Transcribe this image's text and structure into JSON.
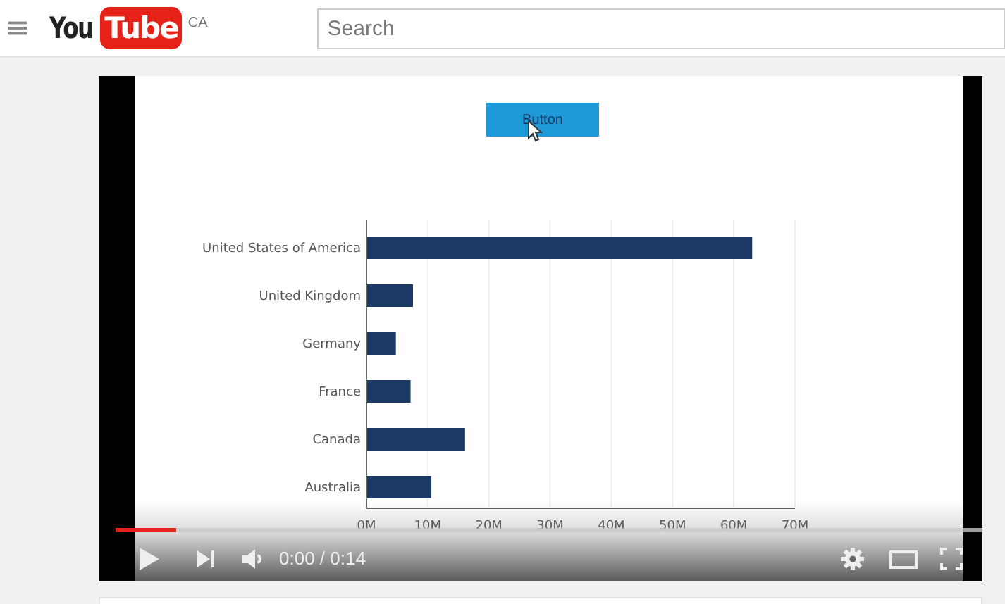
{
  "header": {
    "logo_you": "You",
    "logo_tube": "Tube",
    "country": "CA",
    "search": {
      "placeholder": "Search"
    }
  },
  "video": {
    "frame_button": "Button",
    "chart_data": {
      "type": "bar",
      "orientation": "horizontal",
      "categories": [
        "United States of America",
        "United Kingdom",
        "Germany",
        "France",
        "Canada",
        "Australia"
      ],
      "values": [
        63,
        7.6,
        4.8,
        7.2,
        16.1,
        10.6
      ],
      "grid": true,
      "xlim": [
        0,
        70
      ],
      "xticks": [
        {
          "value": 0,
          "label": "0M"
        },
        {
          "value": 10,
          "label": "10M"
        },
        {
          "value": 20,
          "label": "20M"
        },
        {
          "value": 30,
          "label": "30M"
        },
        {
          "value": 40,
          "label": "40M"
        },
        {
          "value": 50,
          "label": "50M"
        },
        {
          "value": 60,
          "label": "60M"
        },
        {
          "value": 70,
          "label": "70M"
        }
      ]
    },
    "player": {
      "level": 0.07,
      "time": "0:00 / 0:14"
    }
  }
}
